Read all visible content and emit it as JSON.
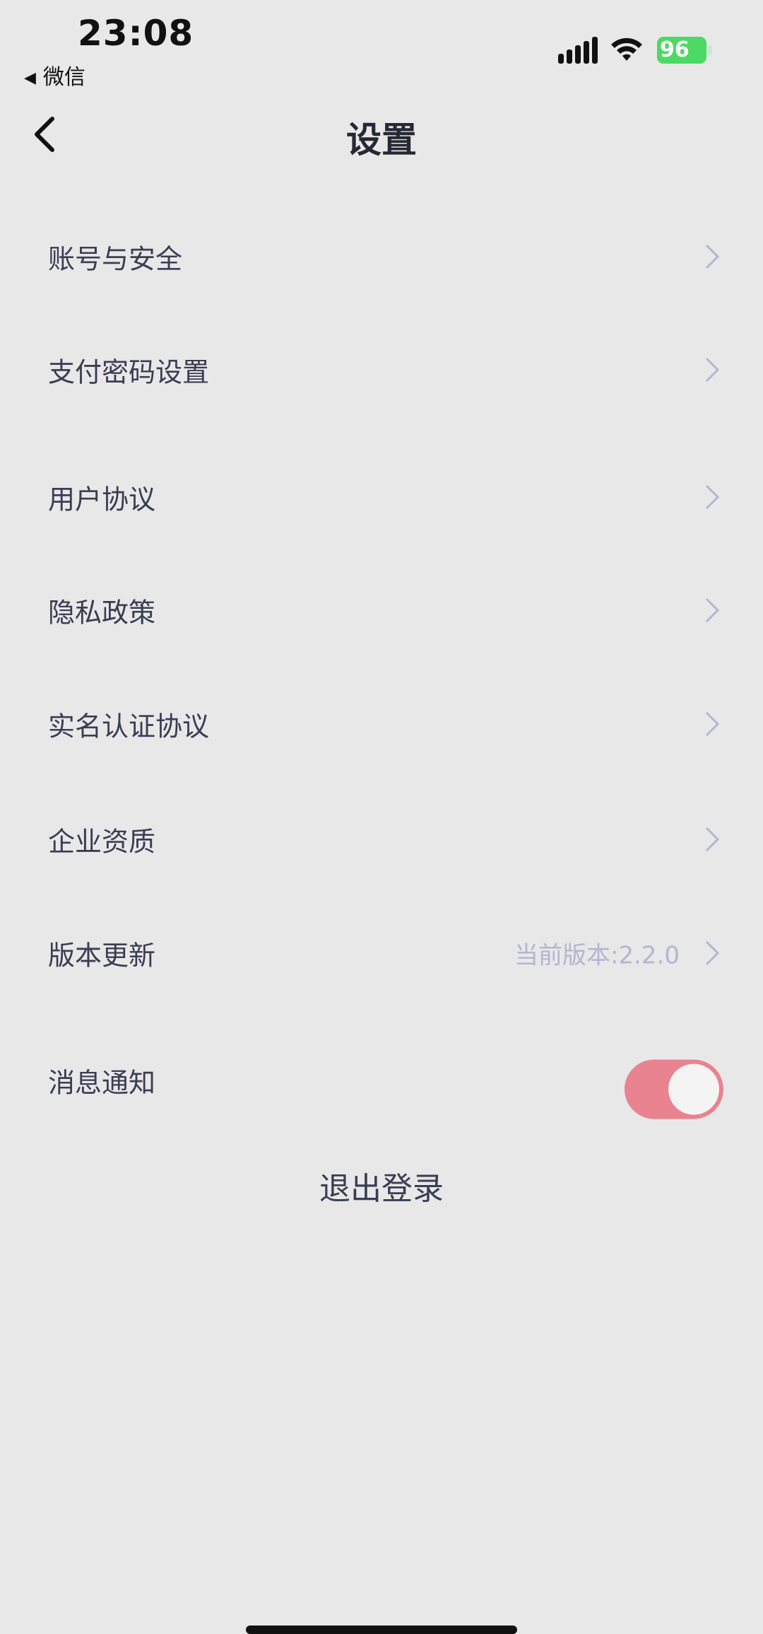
{
  "status_bar": {
    "time": "23:08",
    "back_app": "微信",
    "battery_level": "96",
    "icons": [
      "signal-icon",
      "wifi-icon",
      "battery-icon"
    ]
  },
  "nav": {
    "title": "设置",
    "back_icon": "chevron-left-icon"
  },
  "settings": {
    "account_security": "账号与安全",
    "payment_password": "支付密码设置",
    "user_agreement": "用户协议",
    "privacy_policy": "隐私政策",
    "realname_agreement": "实名认证协议",
    "company_qualification": "企业资质",
    "version_update": "版本更新",
    "version_value": "当前版本:2.2.0",
    "notifications": "消息通知",
    "notifications_enabled": true
  },
  "logout_label": "退出登录",
  "colors": {
    "background": "#e8e8e9",
    "toggle_on": "#e8838f",
    "chevron": "#b4b5cf",
    "battery": "#4cd964"
  }
}
